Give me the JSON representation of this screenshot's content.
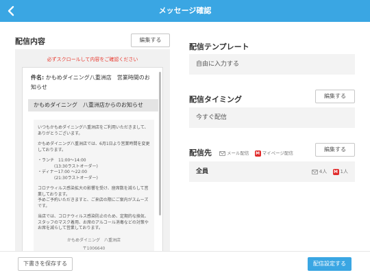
{
  "header": {
    "title": "メッセージ確認",
    "back_icon": "chevron-left-icon"
  },
  "left": {
    "section_label": "配信内容",
    "edit_label": "編集する",
    "warning": "必ずスクロールして内容をご確認ください",
    "subject_prefix": "件名:",
    "subject_text": "かもめダイニング八重洲店　営業時間のお知らせ",
    "mail_heading": "かもめダイニング　八重洲店からのお知らせ",
    "body_paragraphs": [
      "いつもかもめダイニング八重洲店をご利用いただきまして、ありがとうございます。",
      "かもめダイニング八重洲店では、6月1日より営業時間を変更しております。",
      "・ランチ　11:00〜14:00\n　　　　(13:30ラストオーダー)\n・ディナー17:00 〜22:00\n　　　　(21:30ラストオーダー)",
      "コロナウィルス感染拡大の影響を受け、座席数を減らして営業しております。\n予めご予約いただきますと、ご来店の際にご案内がスムーズです。",
      "当店では、コロナウィルス感染防止のため、定期的な換気、スタッフのマスク着用、お席のアルコール消毒などの対策や\nお席を減らして営業しております。"
    ],
    "footer_name": "かもめダイニング　八重洲店",
    "footer_code": "〒1006640"
  },
  "template": {
    "label": "配信テンプレート",
    "value": "自由に入力する"
  },
  "timing": {
    "label": "配信タイミング",
    "edit_label": "編集する",
    "value": "今すぐ配信"
  },
  "destination": {
    "label": "配信先",
    "edit_label": "編集する",
    "mail_chip": "メール配信",
    "mypage_chip": "マイページ配信",
    "mypage_glyph": "M",
    "recipient": "全員",
    "mail_count": "4人",
    "mypage_count": "1人"
  },
  "footer": {
    "save_draft": "下書きを保存する",
    "submit": "配信設定する"
  },
  "colors": {
    "accent": "#3aa6e3",
    "warning": "#e8382d",
    "mypage_badge": "#e02b2b"
  }
}
